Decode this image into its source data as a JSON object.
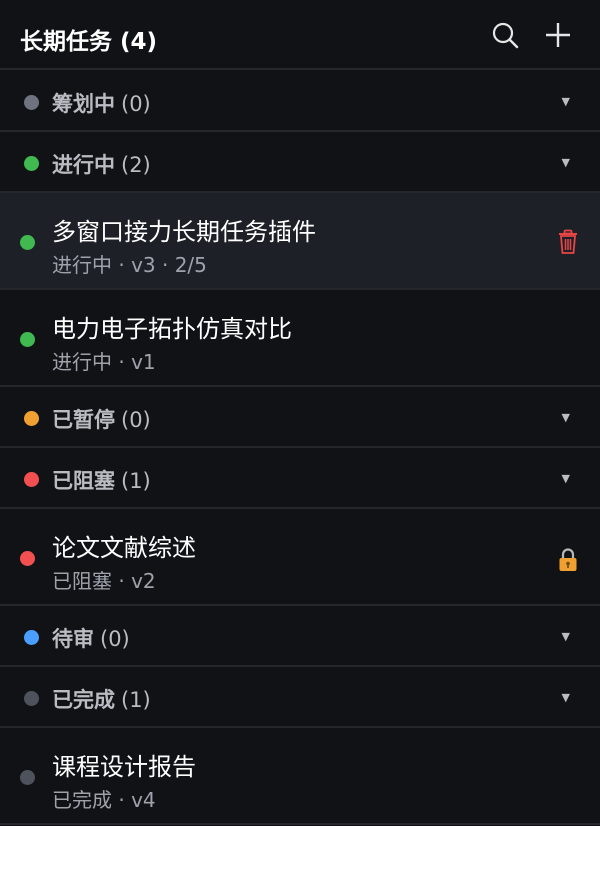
{
  "header": {
    "title": "长期任务 (4)",
    "search_icon": "search-icon",
    "add_icon": "plus-icon"
  },
  "colors": {
    "planning": "#6f7380",
    "in_progress": "#3fb950",
    "paused": "#f0a030",
    "blocked": "#f25050",
    "review": "#4a9eff",
    "done": "#4e525c"
  },
  "groups": [
    {
      "name": "筹划中",
      "count": "(0)"
    },
    {
      "name": "进行中",
      "count": "(2)"
    },
    {
      "name": "已暂停",
      "count": "(0)"
    },
    {
      "name": "已阻塞",
      "count": "(1)"
    },
    {
      "name": "待审",
      "count": "(0)"
    },
    {
      "name": "已完成",
      "count": "(1)"
    }
  ],
  "tasks": [
    {
      "name": "多窗口接力长期任务插件",
      "sub": "进行中 · v3 · 2/5",
      "action_icon": "trash-icon"
    },
    {
      "name": "电力电子拓扑仿真对比",
      "sub": "进行中 · v1"
    },
    {
      "name": "论文文献综述",
      "sub": "已阻塞 · v2",
      "action_icon": "lock-icon"
    },
    {
      "name": "课程设计报告",
      "sub": "已完成 · v4"
    }
  ]
}
